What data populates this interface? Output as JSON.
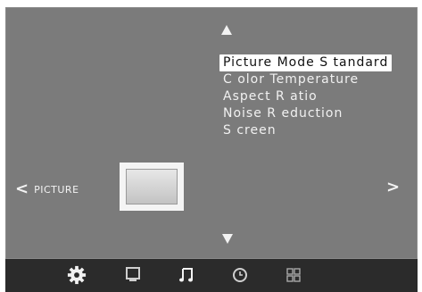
{
  "menu": {
    "items": [
      {
        "label": "Picture Mode S tandard",
        "selected": true
      },
      {
        "label": "C olor Temperature",
        "selected": false
      },
      {
        "label": "Aspect R atio",
        "selected": false
      },
      {
        "label": "Noise R eduction",
        "selected": false
      },
      {
        "label": "S creen",
        "selected": false
      }
    ],
    "section_label": "PICTURE",
    "left_chevron": "<",
    "right_chevron": ">"
  },
  "taskbar": {
    "tabs": [
      {
        "icon": "gear-icon",
        "active": true
      },
      {
        "icon": "monitor-icon",
        "active": false
      },
      {
        "icon": "music-note-icon",
        "active": false
      },
      {
        "icon": "clock-icon",
        "active": false
      },
      {
        "icon": "grid-icon",
        "active": false
      }
    ]
  },
  "colors": {
    "panel_bg": "#7b7b7b",
    "taskbar_bg": "#2b2b2b",
    "selection_bg": "#ffffff",
    "text": "#f1f1f1"
  }
}
